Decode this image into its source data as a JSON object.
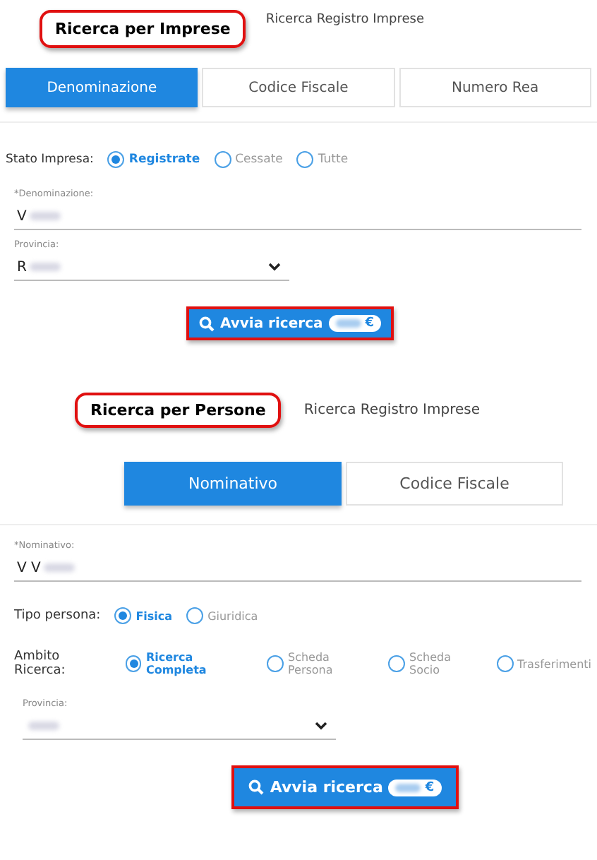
{
  "sections": [
    {
      "callout": "Ricerca per Imprese",
      "subtitle": "Ricerca Registro Imprese",
      "tabs": [
        {
          "label": "Denominazione",
          "selected": true
        },
        {
          "label": "Codice Fiscale",
          "selected": false
        },
        {
          "label": "Numero Rea",
          "selected": false
        }
      ],
      "fields": [
        {
          "kind": "radio",
          "label": "Stato Impresa:",
          "options": [
            {
              "label": "Registrate",
              "selected": true
            },
            {
              "label": "Cessate",
              "selected": false
            },
            {
              "label": "Tutte",
              "selected": false
            }
          ]
        },
        {
          "kind": "text",
          "label": "*Denominazione:",
          "value": "V"
        },
        {
          "kind": "select",
          "label": "Provincia:",
          "value": "R"
        }
      ],
      "button": {
        "label": "Avvia ricerca",
        "price": "€"
      }
    },
    {
      "callout": "Ricerca per Persone",
      "subtitle": "Ricerca Registro Imprese",
      "tabs": [
        {
          "label": "Nominativo",
          "selected": true
        },
        {
          "label": "Codice Fiscale",
          "selected": false
        }
      ],
      "fields": [
        {
          "kind": "text",
          "label": "*Nominativo:",
          "value": "V V"
        },
        {
          "kind": "radio",
          "label": "Tipo persona:",
          "options": [
            {
              "label": "Fisica",
              "selected": true
            },
            {
              "label": "Giuridica",
              "selected": false
            }
          ]
        },
        {
          "kind": "radio",
          "label": "Ambito Ricerca:",
          "options": [
            {
              "label": "Ricerca Completa",
              "selected": true
            },
            {
              "label": "Scheda Persona",
              "selected": false
            },
            {
              "label": "Scheda Socio",
              "selected": false
            },
            {
              "label": "Trasferimenti",
              "selected": false
            }
          ]
        },
        {
          "kind": "select",
          "label": "Provincia:"
        }
      ],
      "button": {
        "label": "Avvia ricerca",
        "price": "€"
      }
    }
  ]
}
